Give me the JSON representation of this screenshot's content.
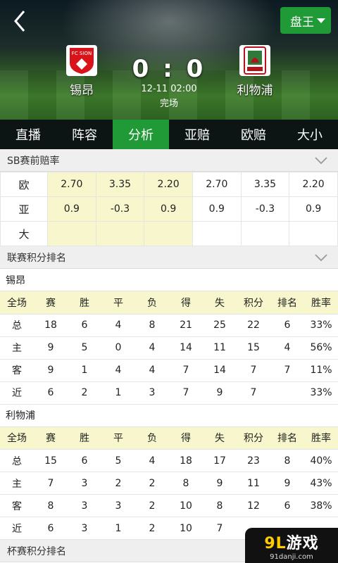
{
  "header": {
    "king_label": "盘王",
    "home_team": "锡昂",
    "home_badge_text": "FC SION",
    "away_team": "利物浦",
    "home_score": "0",
    "separator": ":",
    "away_score": "0",
    "match_time": "12-11 02:00",
    "match_status": "完场"
  },
  "tabs": [
    {
      "label": "直播"
    },
    {
      "label": "阵容"
    },
    {
      "label": "分析"
    },
    {
      "label": "亚赔"
    },
    {
      "label": "欧赔"
    },
    {
      "label": "大小"
    }
  ],
  "odds_section": {
    "title": "SB赛前赔率",
    "rows": [
      {
        "label": "欧",
        "cells": [
          "2.70",
          "3.35",
          "2.20",
          "2.70",
          "3.35",
          "2.20"
        ]
      },
      {
        "label": "亚",
        "cells": [
          "0.9",
          "-0.3",
          "0.9",
          "0.9",
          "-0.3",
          "0.9"
        ]
      },
      {
        "label": "大",
        "cells": [
          "",
          "",
          "",
          "",
          "",
          ""
        ]
      }
    ]
  },
  "standings_section": {
    "title": "联赛积分排名",
    "columns": [
      "全场",
      "赛",
      "胜",
      "平",
      "负",
      "得",
      "失",
      "积分",
      "排名",
      "胜率"
    ],
    "teams": [
      {
        "name": "锡昂",
        "rows": [
          [
            "总",
            "18",
            "6",
            "4",
            "8",
            "21",
            "25",
            "22",
            "6",
            "33%"
          ],
          [
            "主",
            "9",
            "5",
            "0",
            "4",
            "14",
            "11",
            "15",
            "4",
            "56%"
          ],
          [
            "客",
            "9",
            "1",
            "4",
            "4",
            "7",
            "14",
            "7",
            "7",
            "11%"
          ],
          [
            "近",
            "6",
            "2",
            "1",
            "3",
            "7",
            "9",
            "7",
            "",
            "33%"
          ]
        ]
      },
      {
        "name": "利物浦",
        "rows": [
          [
            "总",
            "15",
            "6",
            "5",
            "4",
            "18",
            "17",
            "23",
            "8",
            "40%"
          ],
          [
            "主",
            "7",
            "3",
            "2",
            "2",
            "8",
            "9",
            "11",
            "9",
            "43%"
          ],
          [
            "客",
            "8",
            "3",
            "3",
            "2",
            "10",
            "8",
            "12",
            "6",
            "38%"
          ],
          [
            "近",
            "6",
            "3",
            "1",
            "2",
            "10",
            "7",
            "",
            "",
            ""
          ]
        ]
      }
    ]
  },
  "cup_section": {
    "title": "杯赛积分排名"
  },
  "watermark": {
    "logo_text": "9L",
    "logo_cn": "游戏",
    "site": "91danji.com"
  }
}
